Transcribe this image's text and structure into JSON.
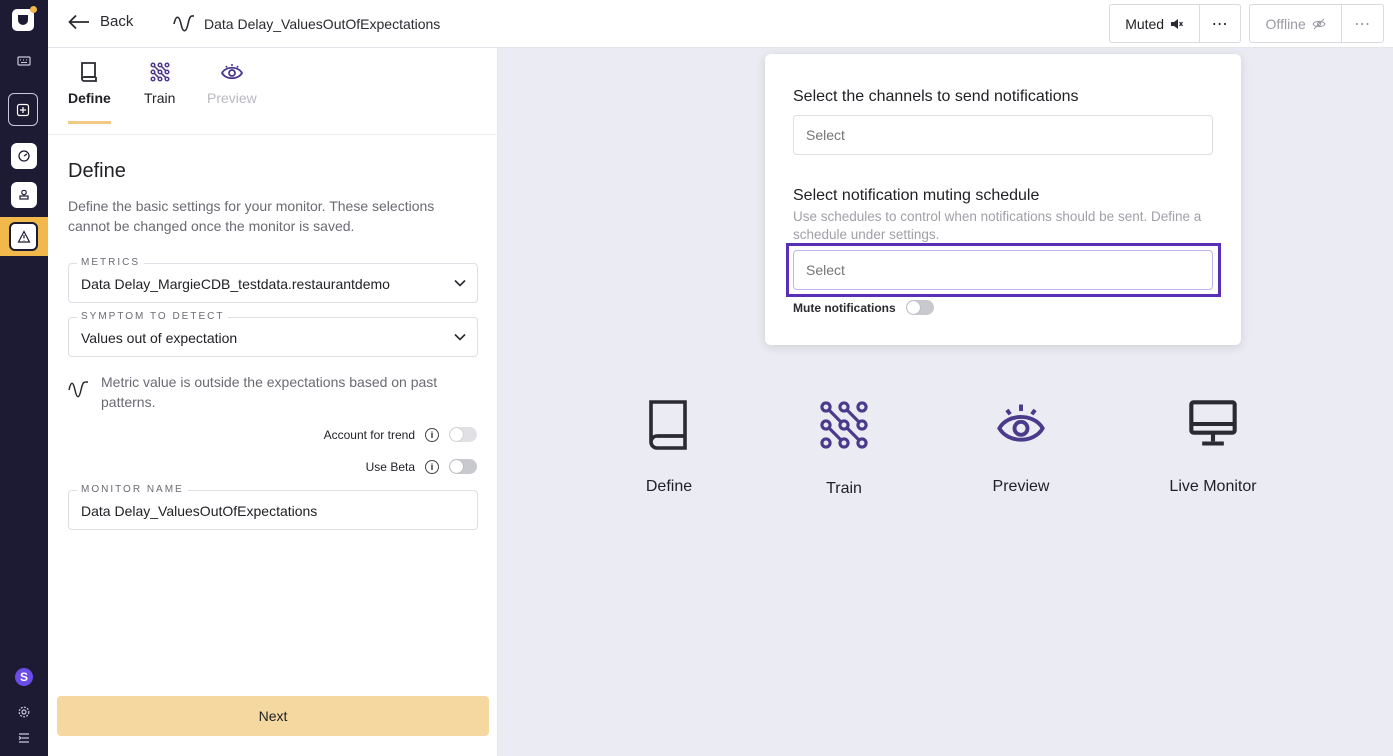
{
  "topbar": {
    "back_label": "Back",
    "monitor_title": "Data Delay_ValuesOutOfExpectations",
    "muted_label": "Muted",
    "offline_label": "Offline"
  },
  "tabs": [
    {
      "label": "Define",
      "state": "active"
    },
    {
      "label": "Train",
      "state": "normal"
    },
    {
      "label": "Preview",
      "state": "disabled"
    }
  ],
  "define": {
    "heading": "Define",
    "description": "Define the basic settings for your monitor. These selections cannot be changed once the monitor is saved.",
    "metrics_label": "METRICS",
    "metrics_value": "Data Delay_MargieCDB_testdata.restaurantdemo",
    "symptom_label": "SYMPTOM TO DETECT",
    "symptom_value": "Values out of expectation",
    "symptom_hint": "Metric value is outside the expectations based on past patterns.",
    "account_for_trend_label": "Account for trend",
    "use_beta_label": "Use Beta",
    "monitor_name_label": "MONITOR NAME",
    "monitor_name_value": "Data Delay_ValuesOutOfExpectations",
    "next_label": "Next"
  },
  "notifications": {
    "channels_title": "Select the channels to send notifications",
    "channels_placeholder": "Select",
    "schedule_title": "Select notification muting schedule",
    "schedule_subtitle": "Use schedules to control when notifications should be sent. Define a schedule under settings.",
    "schedule_placeholder": "Select",
    "mute_label": "Mute notifications"
  },
  "steps": [
    {
      "label": "Define"
    },
    {
      "label": "Train"
    },
    {
      "label": "Preview"
    },
    {
      "label": "Live Monitor"
    }
  ],
  "rail": {
    "avatar_letter": "S"
  },
  "colors": {
    "accent": "#f1b84b",
    "primary": "#4b3a8c",
    "rail_bg": "#1d1a33",
    "focus_outline": "#5a2fb8",
    "next_button": "#f4d89f"
  }
}
